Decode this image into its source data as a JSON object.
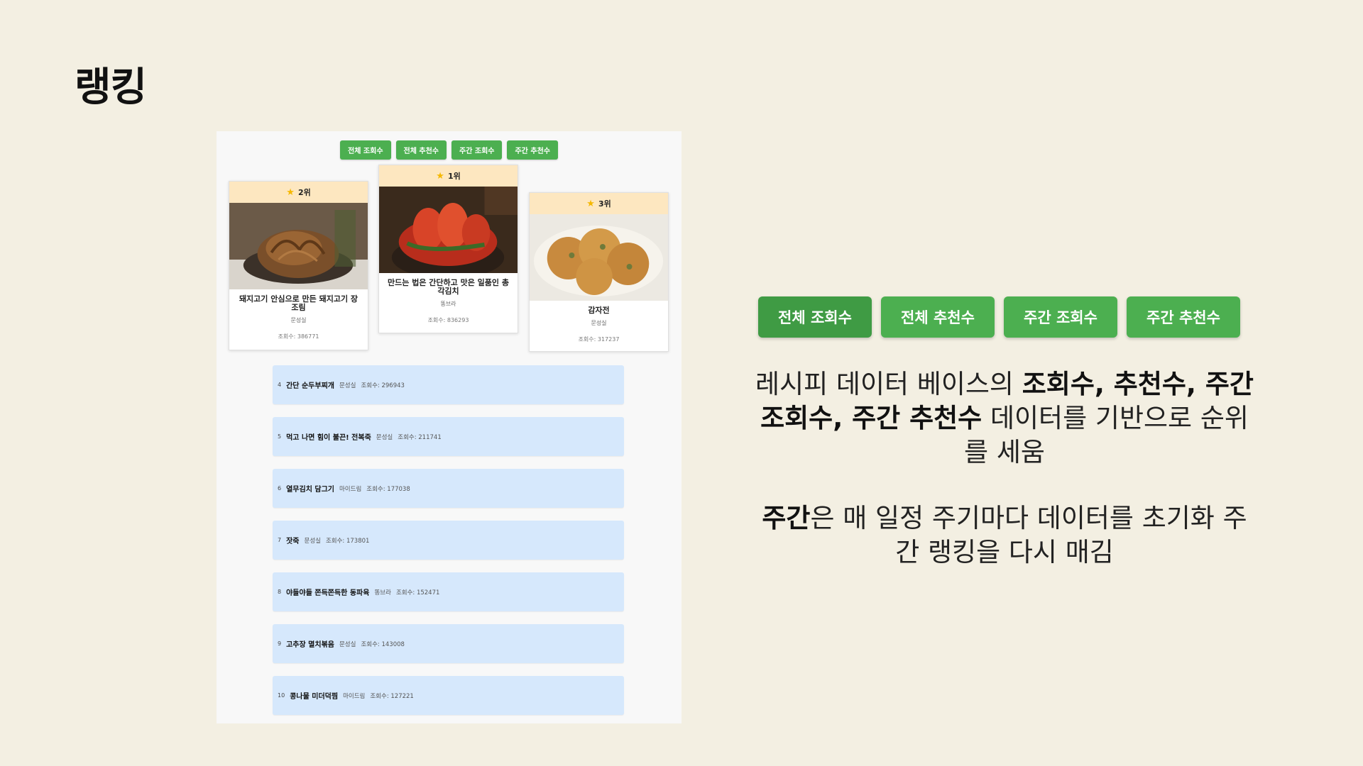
{
  "slide": {
    "title": "랭킹"
  },
  "tabs": [
    "전체 조회수",
    "전체 추천수",
    "주간 조회수",
    "주간 추천수"
  ],
  "top3": [
    {
      "rank": "2위",
      "name": "돼지고기 안심으로 만든 돼지고기 장조림",
      "author": "문성실",
      "views": "조회수: 386771"
    },
    {
      "rank": "1위",
      "name": "만드는 법은 간단하고 맛은 일품인 총각김치",
      "author": "똥브라",
      "views": "조회수: 836293"
    },
    {
      "rank": "3위",
      "name": "감자전",
      "author": "문성실",
      "views": "조회수: 317237"
    }
  ],
  "list": [
    {
      "num": "4",
      "name": "간단 순두부찌개",
      "author": "문성실",
      "views": "조회수: 296943"
    },
    {
      "num": "5",
      "name": "먹고 나면 힘이 불끈! 전복죽",
      "author": "문성실",
      "views": "조회수: 211741"
    },
    {
      "num": "6",
      "name": "열무김치 담그기",
      "author": "마이드림",
      "views": "조회수: 177038"
    },
    {
      "num": "7",
      "name": "잣죽",
      "author": "문성실",
      "views": "조회수: 173801"
    },
    {
      "num": "8",
      "name": "야들야들 쫀득쫀득한 동파육",
      "author": "똥브라",
      "views": "조회수: 152471"
    },
    {
      "num": "9",
      "name": "고추장 멸치볶음",
      "author": "문성실",
      "views": "조회수: 143008"
    },
    {
      "num": "10",
      "name": "콩나물 미더덕찜",
      "author": "마이드림",
      "views": "조회수: 127221"
    }
  ],
  "description": {
    "p1_a": "레시피 데이터 베이스의 ",
    "p1_b": "조회수, 추천수, 주간 조회수, 주간 추천수",
    "p1_c": " 데이터를 기반으로 순위를 세움",
    "p2_a": "주간",
    "p2_b": "은 매 일정 주기마다 데이터를 초기화 주간 랭킹을 다시 매김"
  },
  "colors": {
    "background": "#f3efe2",
    "tab_green": "#4caf50",
    "rank_header": "#fde7c0",
    "list_row": "#d6e8fc"
  }
}
